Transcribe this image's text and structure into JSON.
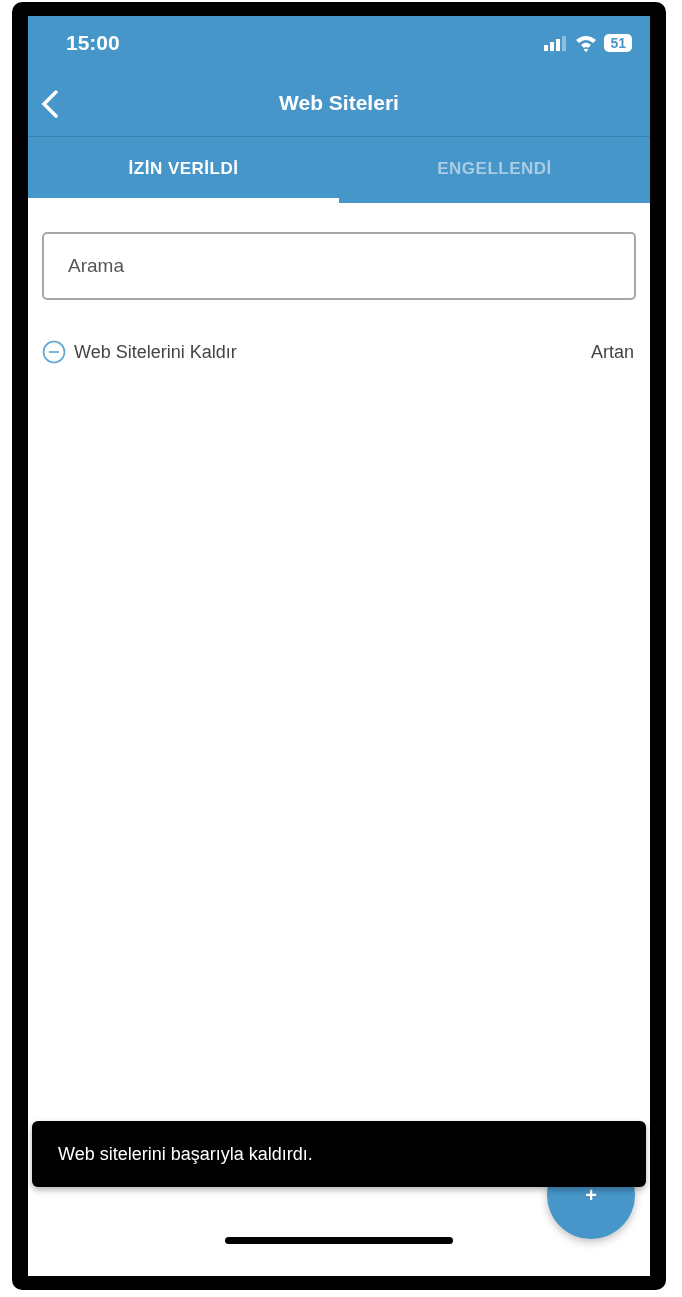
{
  "status_bar": {
    "time": "15:00",
    "battery": "51"
  },
  "header": {
    "title": "Web Siteleri"
  },
  "tabs": [
    {
      "label": "İZİN VERİLDİ",
      "selected": true
    },
    {
      "label": "ENGELLENDİ",
      "selected": false
    }
  ],
  "search": {
    "placeholder": "Arama"
  },
  "list_header": {
    "remove_label": "Web Sitelerini Kaldır",
    "sort_label": "Artan"
  },
  "toast": {
    "message": "Web sitelerini başarıyla kaldırdı."
  },
  "fab": {
    "label": "+"
  }
}
